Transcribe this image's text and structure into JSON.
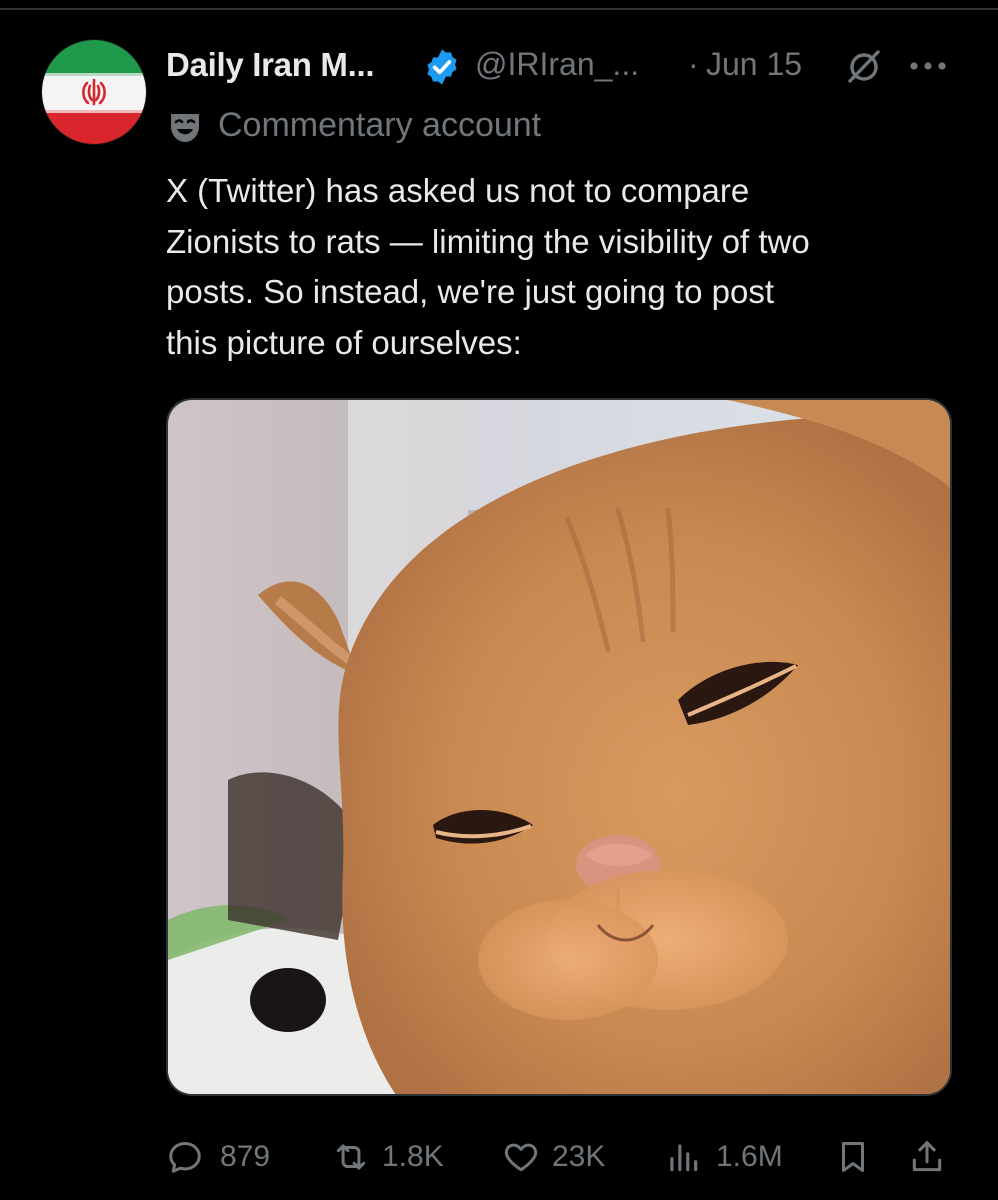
{
  "tweet": {
    "author": {
      "display_name": "Daily Iran M...",
      "handle": "@IRIran_...",
      "verified": true,
      "avatar_icon": "iran-flag-avatar",
      "account_label": "Commentary account",
      "label_icon": "theater-mask-icon"
    },
    "separator": "·",
    "date": "Jun 15",
    "text": "X (Twitter) has asked us not to compare\nZionists to rats — limiting the visibility of two\nposts. So instead, we're just going to post\nthis picture of ourselves:",
    "media": {
      "kind": "image",
      "subject": "cat-photo"
    },
    "metrics": {
      "replies": "879",
      "reposts": "1.8K",
      "likes": "23K",
      "views": "1.6M"
    }
  },
  "colors": {
    "background": "#000000",
    "primary_text": "#e7e9ea",
    "secondary_text": "#71767b",
    "verified_blue": "#1d9bf0",
    "divider": "#2f3336"
  }
}
